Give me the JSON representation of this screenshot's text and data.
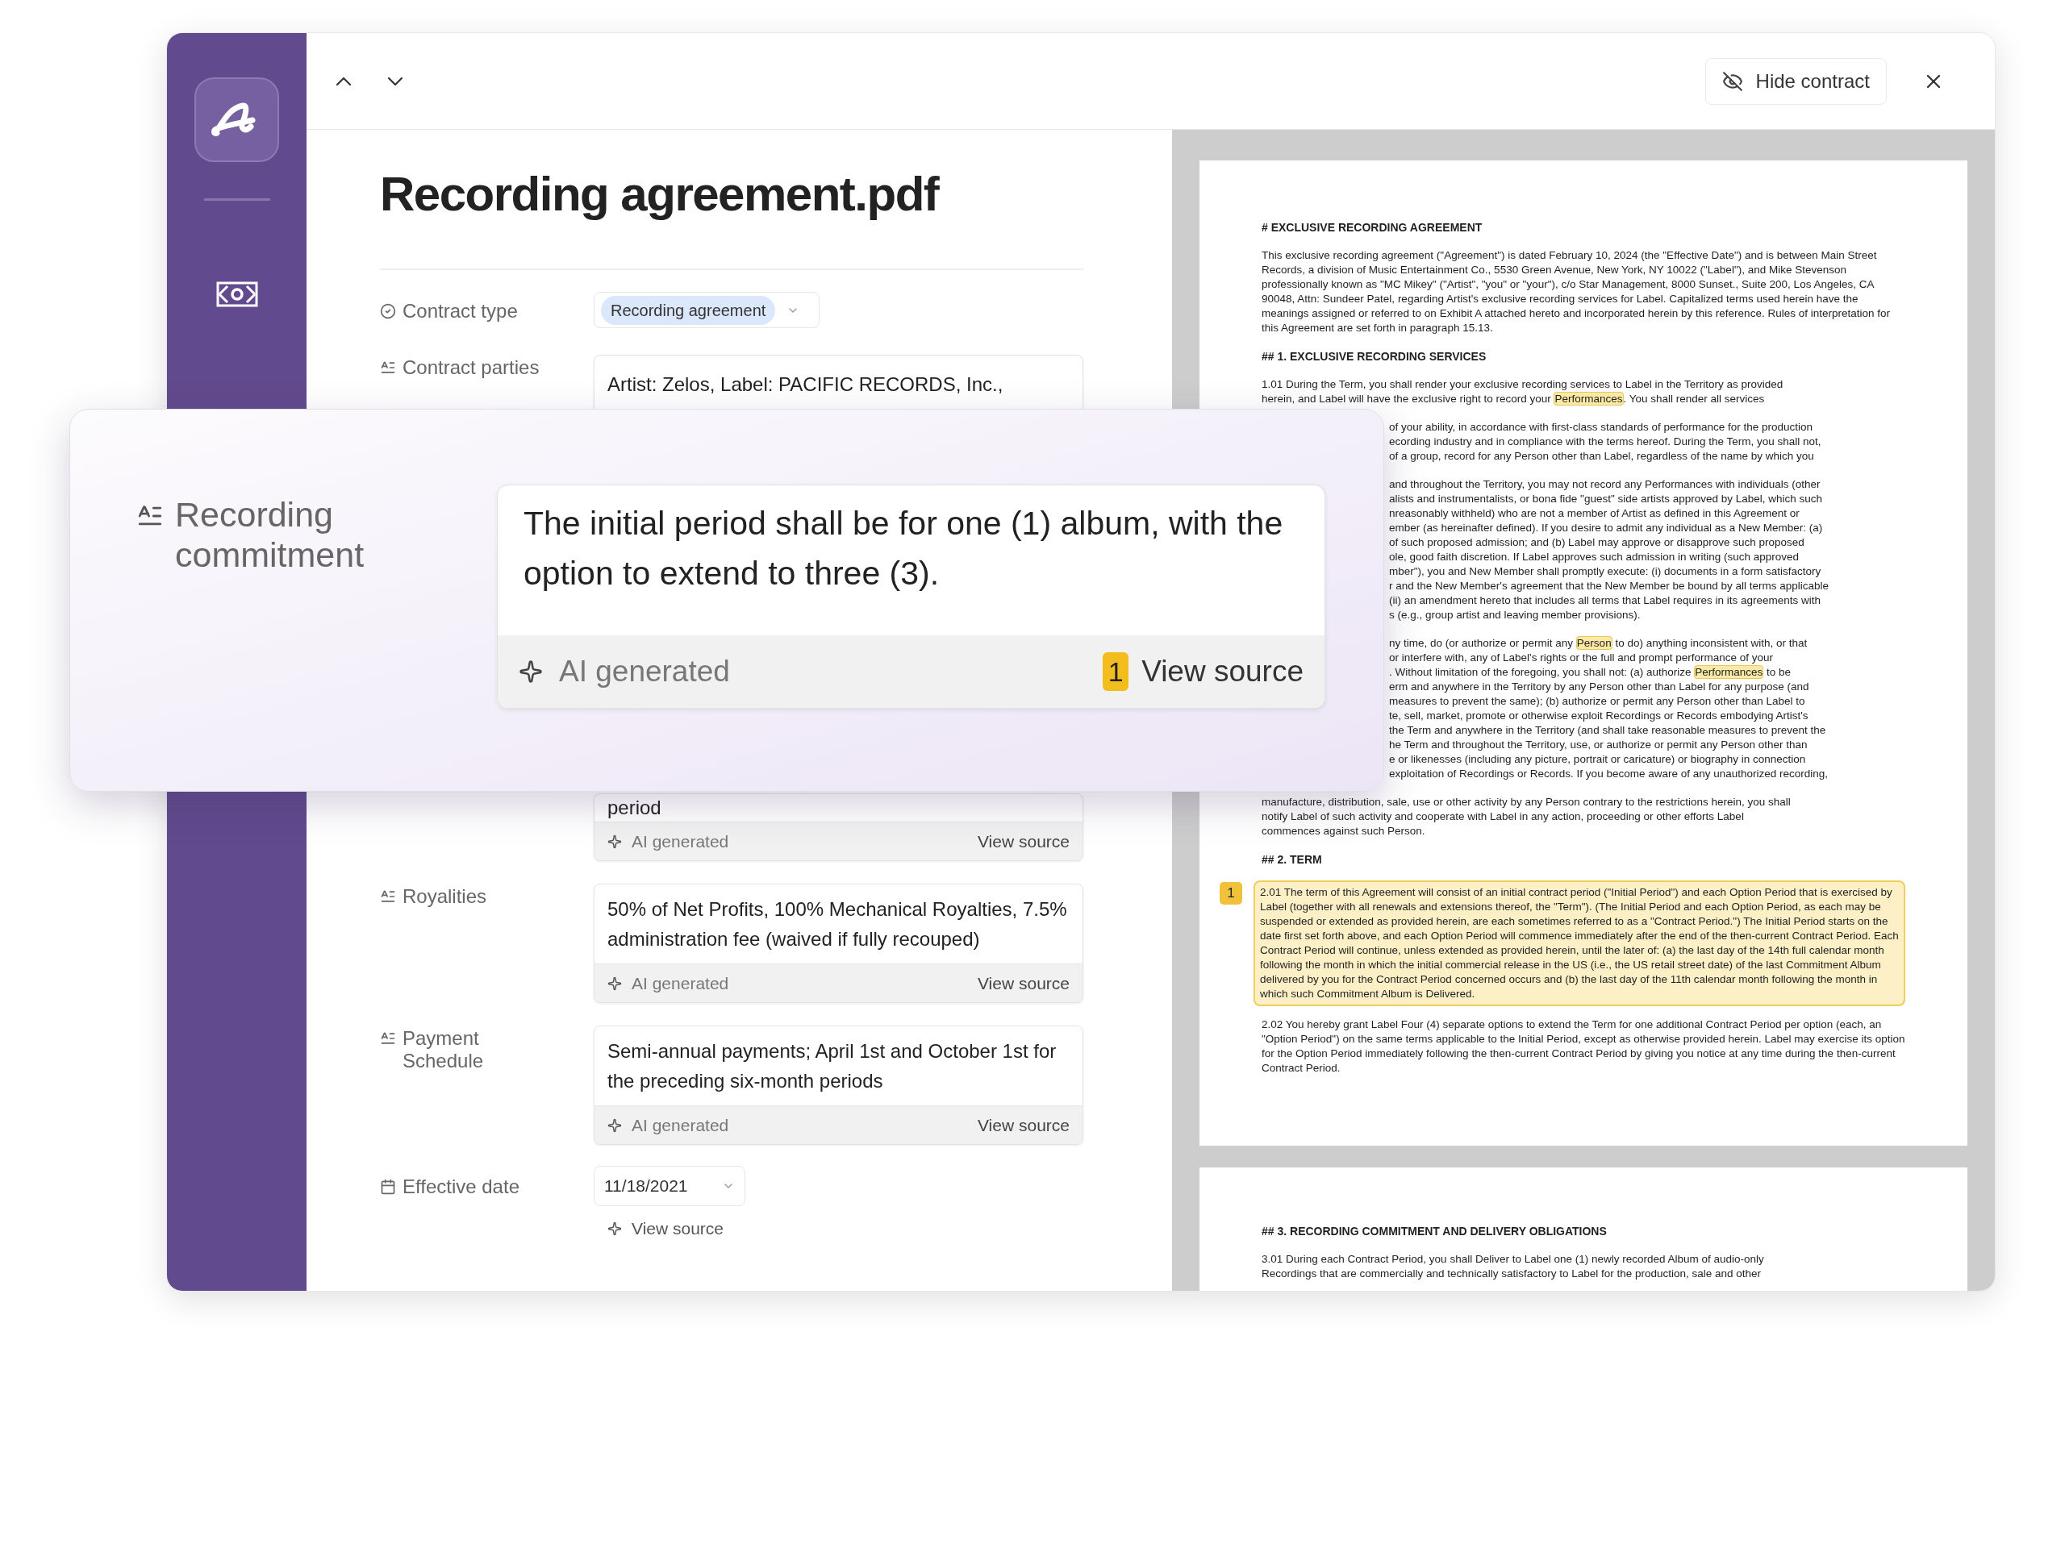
{
  "toolbar": {
    "hide_contract_button": "Hide contract"
  },
  "document_title": "Recording agreement.pdf",
  "fields": [
    {
      "kind": "tag",
      "label": "Contract type",
      "value": "Recording agreement"
    },
    {
      "kind": "partial",
      "label": "Contract parties",
      "value": "Artist: Zelos, Label: PACIFIC RECORDS, Inc.,"
    },
    {
      "kind": "covered",
      "value": "period",
      "footer": {
        "ai_label": "AI generated",
        "source_link": "View source"
      }
    },
    {
      "kind": "text",
      "label": "Royalities",
      "value": "50% of Net Profits, 100% Mechanical Royalties, 7.5% administration fee (waived if fully recouped)",
      "footer": {
        "ai_label": "AI generated",
        "source_link": "View source"
      }
    },
    {
      "kind": "text",
      "label": "Payment Schedule",
      "value": "Semi-annual payments; April 1st and October 1st for the preceding six-month periods",
      "footer": {
        "ai_label": "AI generated",
        "source_link": "View source"
      }
    },
    {
      "kind": "date",
      "label": "Effective date",
      "value": "11/18/2021",
      "source_link": "View source"
    }
  ],
  "popup": {
    "label": "Recording commitment",
    "value": "The initial period shall be for one (1) album, with the option to extend to three (3).",
    "ai_label": "AI generated",
    "source_number": "1",
    "source_link": "View source"
  },
  "document": {
    "pages": [
      {
        "blocks": [
          {
            "kind": "heading",
            "text": "# EXCLUSIVE RECORDING AGREEMENT"
          },
          {
            "kind": "paragraph",
            "text": "This exclusive recording agreement (\"Agreement\") is dated February 10, 2024 (the \"Effective Date\") and is between Main Street Records, a division of Music Entertainment Co., 5530 Green Avenue, New York, NY 10022 (\"Label\"), and Mike Stevenson professionally known as \"MC Mikey\" (\"Artist\", \"you\" or \"your\"), c/o Star Management, 8000 Sunset., Suite 200, Los Angeles, CA 90048, Attn: Sundeer Patel, regarding Artist's exclusive recording services for Label. Capitalized terms used herein have the meanings assigned or referred to on Exhibit A attached hereto and incorporated herein by this reference. Rules of interpretation for this Agreement are set forth in paragraph 15.13."
          },
          {
            "kind": "heading",
            "text": "## 1. EXCLUSIVE RECORDING SERVICES"
          },
          {
            "kind": "lines",
            "lines": [
              "1.01 During the Term, you shall render your exclusive recording services to Label in the Territory as provided",
              [
                {
                  "text": "herein, and Label will have the exclusive right to record your ",
                  "highlighted": false
                },
                {
                  "text": "Performances",
                  "highlighted": true
                },
                {
                  "text": ". You shall render all services",
                  "highlighted": false
                }
              ]
            ]
          },
          {
            "kind": "clipped",
            "lines": [
              "of your ability, in accordance with first-class standards of performance for the production",
              "ecording industry and in compliance with the terms hereof. During the Term, you shall not,",
              "of a group, record for any Person other than Label, regardless of the name by which you"
            ]
          },
          {
            "kind": "clipped",
            "lines": [
              "and throughout the Territory, you may not record any Performances with individuals (other",
              "alists and instrumentalists, or bona fide \"guest\" side artists approved by Label, which such",
              "nreasonably withheld) who are not a member of Artist as defined in this Agreement or",
              "ember (as hereinafter defined). If you desire to admit any individual as a New Member: (a)",
              "of such proposed admission; and (b) Label may approve or disapprove such proposed",
              "ole, good faith discretion. If Label approves such admission in writing (such approved",
              "mber\"), you and New Member shall promptly execute: (i) documents in a form satisfactory",
              "r and the New Member's agreement that the New Member be bound by all terms applicable",
              "(ii) an amendment hereto that includes all terms that Label requires in its agreements with",
              "s (e.g., group artist and leaving member provisions)."
            ]
          },
          {
            "kind": "clipped",
            "lines": [
              [
                {
                  "text": "ny time, do (or authorize or permit any ",
                  "highlighted": false
                },
                {
                  "text": "Person",
                  "highlighted": true
                },
                {
                  "text": " to do) anything inconsistent with, or that",
                  "highlighted": false
                }
              ],
              "or interfere with, any of Label's rights or the full and prompt performance of your",
              [
                {
                  "text": ". Without limitation of the foregoing, you shall not: (a) authorize ",
                  "highlighted": false
                },
                {
                  "text": "Performances",
                  "highlighted": true
                },
                {
                  "text": " to be",
                  "highlighted": false
                }
              ],
              "erm and anywhere in the Territory by any Person other than Label for any purpose (and",
              "measures to prevent the same); (b) authorize or permit any Person other than Label to",
              "te, sell, market, promote or otherwise exploit Recordings or Records embodying Artist's",
              "the Term and anywhere in the Territory (and shall take reasonable measures to prevent the",
              "he Term and throughout the Territory, use, or authorize or permit any Person other than",
              "e or likenesses (including any picture, portrait or caricature) or biography in connection",
              "exploitation of Recordings or Records. If you become aware of any unauthorized recording,"
            ]
          },
          {
            "kind": "lines",
            "lines": [
              "manufacture, distribution, sale, use or other activity by any Person contrary to the restrictions herein, you shall",
              "notify Label of such activity and cooperate with Label in any action, proceeding or other efforts Label",
              "commences against such Person."
            ]
          },
          {
            "kind": "heading",
            "text": "## 2. TERM"
          },
          {
            "kind": "source",
            "badge": "1",
            "highlighted": true,
            "text": "2.01 The term of this Agreement will consist of an initial contract period (\"Initial Period\") and each Option Period that is exercised by Label (together with all renewals and extensions thereof, the \"Term\"). (The Initial Period and each Option Period, as each may be suspended or extended as provided herein, are each sometimes referred to as a \"Contract Period.\") The Initial Period starts on the date first set forth above, and each Option Period will commence immediately after the end of the then-current Contract Period. Each Contract Period will continue, unless extended as provided herein, until the later of: (a) the last day of the 14th full calendar month following the month in which the initial commercial release in the US (i.e., the US retail street date) of the last Commitment Album delivered by you for the Contract Period concerned occurs and (b) the last day of the 11th calendar month following the month in which such Commitment Album is Delivered."
          },
          {
            "kind": "paragraph",
            "text": "2.02 You hereby grant Label Four (4) separate options to extend the Term for one additional Contract Period per option (each, an \"Option Period\") on the same terms applicable to the Initial Period, except as otherwise provided herein. Label may exercise its option for the Option Period immediately following the then-current Contract Period by giving you notice at any time during the then-current Contract Period."
          }
        ]
      },
      {
        "blocks": [
          {
            "kind": "heading",
            "text": "## 3. RECORDING COMMITMENT AND DELIVERY OBLIGATIONS"
          },
          {
            "kind": "lines",
            "lines": [
              "3.01 During each Contract Period, you shall Deliver to Label one (1) newly recorded Album of audio-only",
              "Recordings that are commercially and technically satisfactory to Label for the production, sale and other"
            ]
          }
        ]
      }
    ]
  }
}
